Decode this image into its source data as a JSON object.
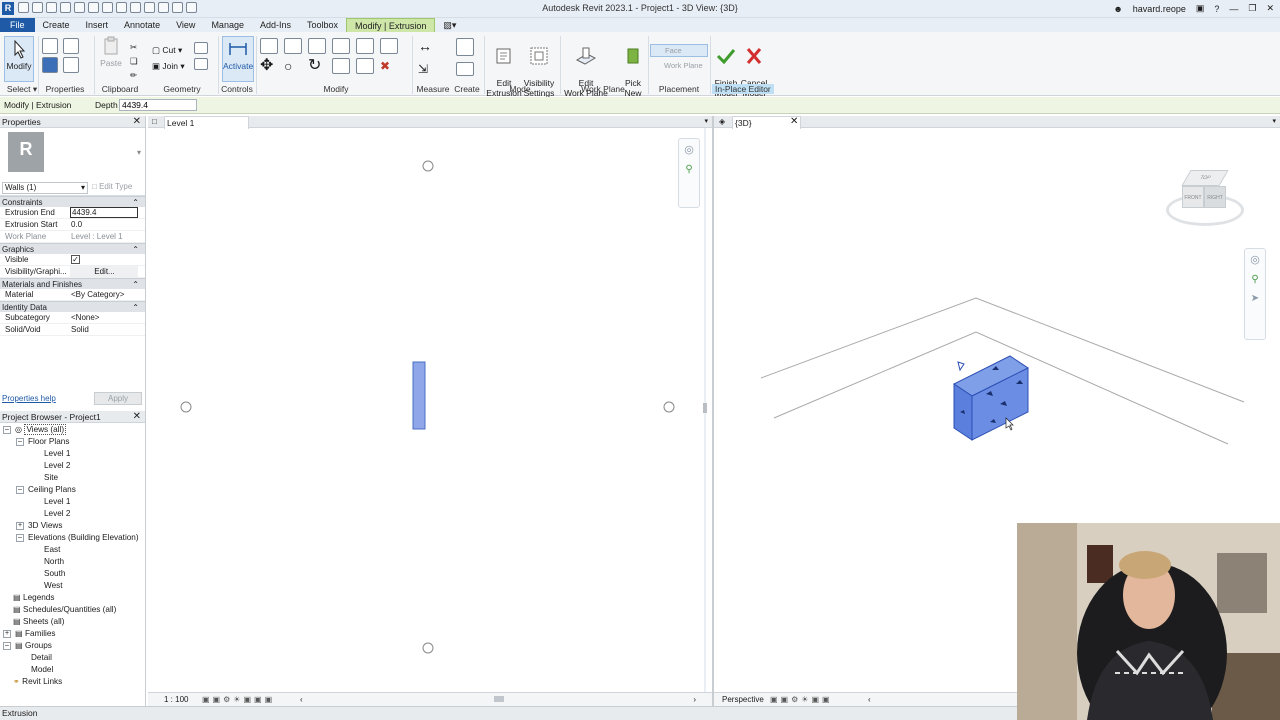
{
  "titlebar": {
    "app_logo": "R",
    "title": "Autodesk Revit 2023.1 - Project1 - 3D View: {3D}",
    "user": "havard.reope"
  },
  "tabs": [
    "File",
    "Create",
    "Insert",
    "Annotate",
    "View",
    "Manage",
    "Add-Ins",
    "Toolbox",
    "Modify | Extrusion"
  ],
  "ribbon": {
    "modify_label": "Modify",
    "clipboard": {
      "paste": "Paste",
      "cut": "Cut",
      "join": "Join"
    },
    "activate": "Activate",
    "edit_extrusion": "Edit\nExtrusion",
    "visibility_settings": "Visibility\nSettings",
    "edit_work_plane": "Edit\nWork Plane",
    "pick_new": "Pick\nNew",
    "face": "Face",
    "work_plane": "Work Plane",
    "finish_model": "Finish\nModel",
    "cancel_model": "Cancel\nModel",
    "panels": {
      "select": "Select",
      "properties": "Properties",
      "clipboard": "Clipboard",
      "geometry": "Geometry",
      "controls": "Controls",
      "modify": "Modify",
      "measure": "Measure",
      "create": "Create",
      "mode": "Mode",
      "work_plane": "Work Plane",
      "placement": "Placement",
      "in_place_editor": "In-Place Editor"
    }
  },
  "options_bar": {
    "context": "Modify | Extrusion",
    "depth_label": "Depth",
    "depth_value": "4439.4"
  },
  "properties": {
    "title": "Properties",
    "type_selector": "Walls (1)",
    "edit_type": "Edit Type",
    "sections": {
      "constraints": "Constraints",
      "graphics": "Graphics",
      "materials": "Materials and Finishes",
      "identity": "Identity Data"
    },
    "extrusion_end": {
      "label": "Extrusion End",
      "value": "4439.4"
    },
    "extrusion_start": {
      "label": "Extrusion Start",
      "value": "0.0"
    },
    "work_plane": {
      "label": "Work Plane",
      "value": "Level : Level 1"
    },
    "visible": {
      "label": "Visible"
    },
    "vis_graphics": {
      "label": "Visibility/Graphi...",
      "value": "Edit..."
    },
    "material": {
      "label": "Material",
      "value": "<By Category>"
    },
    "subcategory": {
      "label": "Subcategory",
      "value": "<None>"
    },
    "solid_void": {
      "label": "Solid/Void",
      "value": "Solid"
    },
    "help": "Properties help",
    "apply": "Apply"
  },
  "browser": {
    "title": "Project Browser - Project1",
    "views_all": "Views (all)",
    "floor_plans": "Floor Plans",
    "fp_level1": "Level 1",
    "fp_level2": "Level 2",
    "fp_site": "Site",
    "ceiling_plans": "Ceiling Plans",
    "cp_level1": "Level 1",
    "cp_level2": "Level 2",
    "views_3d": "3D Views",
    "elevations": "Elevations (Building Elevation)",
    "east": "East",
    "north": "North",
    "south": "South",
    "west": "West",
    "legends": "Legends",
    "schedules": "Schedules/Quantities (all)",
    "sheets": "Sheets (all)",
    "families": "Families",
    "groups": "Groups",
    "detail": "Detail",
    "model": "Model",
    "revit_links": "Revit Links"
  },
  "view1": {
    "tab": "Level 1",
    "scale": "1 : 100"
  },
  "view2": {
    "tab": "{3D}",
    "mode": "Perspective",
    "viewcube_top": "TOP",
    "viewcube_front": "FRONT",
    "viewcube_right": "RIGHT"
  },
  "statusbar": {
    "text": "Extrusion"
  },
  "colors": {
    "file_tab": "#1f5aa6",
    "context_tab": "#cfe6a9",
    "extrusion_fill": "#4a78d8",
    "options_bar": "#eef5e2"
  }
}
